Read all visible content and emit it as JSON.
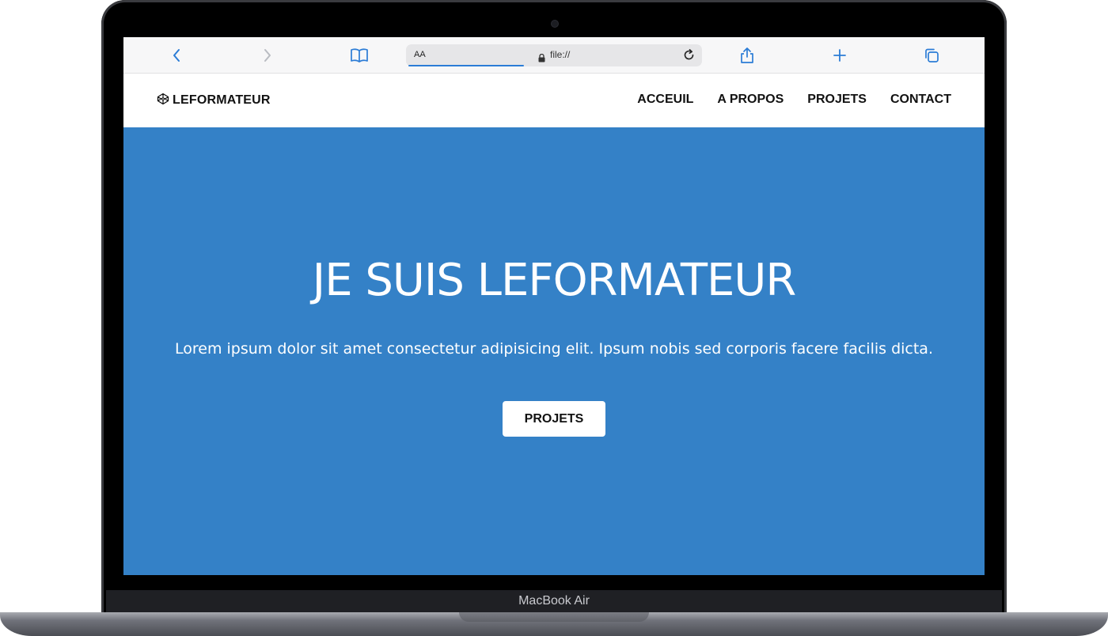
{
  "device": {
    "label": "MacBook Air"
  },
  "browser": {
    "toolbar": {
      "back_icon": "chevron-left-icon",
      "forward_icon": "chevron-right-icon",
      "bookmarks_icon": "book-icon",
      "share_icon": "share-icon",
      "new_tab_icon": "plus-icon",
      "tabs_icon": "tabs-icon"
    },
    "address": {
      "reader_label": "AA",
      "url": "file://"
    }
  },
  "site": {
    "logo": {
      "text": "LEFORMATEUR",
      "icon": "codepen-icon"
    },
    "nav": [
      {
        "label": "ACCEUIL"
      },
      {
        "label": "A PROPOS"
      },
      {
        "label": "PROJETS"
      },
      {
        "label": "CONTACT"
      }
    ],
    "hero": {
      "title": "JE SUIS LEFORMATEUR",
      "text": "Lorem ipsum dolor sit amet consectetur adipisicing elit. Ipsum nobis sed corporis facere facilis dicta.",
      "button_label": "PROJETS"
    }
  },
  "colors": {
    "hero_background": "#3481c7",
    "accent_blue": "#2b7cd6",
    "nav_text": "#111111"
  }
}
